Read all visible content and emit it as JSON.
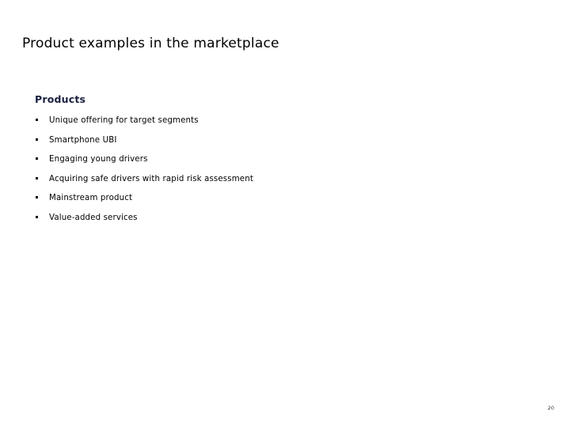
{
  "slide": {
    "title": "Product examples in the marketplace",
    "page_number": "20",
    "background_color": "#ffffff",
    "title_color": "#000000",
    "heading_color": "#1a2040",
    "body_color": "#000000"
  },
  "content": {
    "section_heading": "Products",
    "bullets": [
      {
        "text": "Unique offering for target segments",
        "marker": "square-bullet"
      },
      {
        "text": "Smartphone UBI",
        "marker": "square-bullet"
      },
      {
        "text": "Engaging young drivers",
        "marker": "square-bullet"
      },
      {
        "text": "Acquiring safe drivers with rapid risk assessment",
        "marker": "square-bullet"
      },
      {
        "text": "Mainstream product",
        "marker": "square-bullet"
      },
      {
        "text": "Value-added services",
        "marker": "square-bullet"
      }
    ]
  }
}
